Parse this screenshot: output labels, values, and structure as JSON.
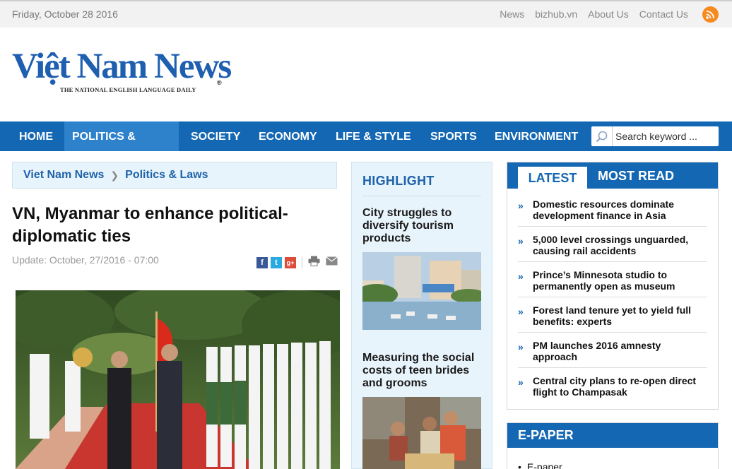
{
  "topbar": {
    "date": "Friday, October 28 2016",
    "links": [
      "News",
      "bizhub.vn",
      "About Us",
      "Contact Us"
    ],
    "rss_icon": "rss-icon"
  },
  "logo": {
    "name": "Việt Nam News",
    "tagline": "THE NATIONAL ENGLISH LANGUAGE DAILY",
    "reg_mark": "®",
    "brand_color": "#1f5fb0"
  },
  "nav": {
    "items": [
      "HOME",
      "POLITICS & LAWS",
      "SOCIETY",
      "ECONOMY",
      "LIFE & STYLE",
      "SPORTS",
      "ENVIRONMENT"
    ],
    "active": "POLITICS & LAWS",
    "search_placeholder": "Search keyword ...",
    "bar_color": "#1467b3"
  },
  "breadcrumb": {
    "items": [
      "Viet Nam News",
      "Politics & Laws"
    ]
  },
  "article": {
    "title": "VN, Myanmar to enhance political-diplomatic ties",
    "update": "Update: October, 27/2016 - 07:00",
    "share": {
      "facebook": "f",
      "twitter": "t",
      "googleplus": "g+"
    }
  },
  "highlight": {
    "heading": "HIGHLIGHT",
    "items": [
      "City struggles to diversify tourism products",
      "Measuring the social costs of teen brides and grooms"
    ]
  },
  "latest": {
    "tab_latest": "LATEST",
    "tab_most_read": "MOST READ",
    "items": [
      "Domestic resources dominate development finance in Asia",
      "5,000 level crossings unguarded, causing rail accidents",
      "Prince’s Minnesota studio to permanently open as museum",
      "Forest land tenure yet to yield full benefits: experts",
      "PM launches 2016 amnesty approach",
      "Central city plans to re-open direct flight to Champasak"
    ]
  },
  "epaper": {
    "heading": "E-PAPER",
    "item": "E-paper"
  }
}
